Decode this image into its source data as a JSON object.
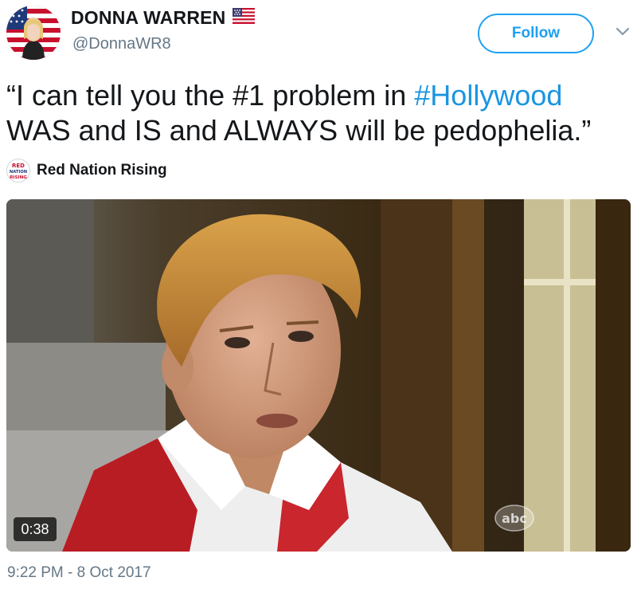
{
  "author": {
    "display_name": "DONNA WARREN",
    "handle": "@DonnaWR8",
    "name_badge_icon": "us-flag-icon",
    "avatar_icon": "profile-avatar"
  },
  "actions": {
    "follow_label": "Follow",
    "menu_icon": "chevron-down-icon"
  },
  "tweet": {
    "text_before": "“I can tell you the #1 problem in ",
    "hashtag": "#Hollywood",
    "text_after": " WAS and IS and ALWAYS will be pedophelia.”"
  },
  "attribution": {
    "logo_text": [
      "RED",
      "NATION",
      "RISING"
    ],
    "name": "Red Nation Rising"
  },
  "video": {
    "duration": "0:38",
    "watermark": "abc"
  },
  "meta": {
    "timestamp": "9:22 PM - 8 Oct 2017"
  },
  "colors": {
    "accent": "#1da1f2",
    "hashtag": "#1b95e0",
    "secondary_text": "#657786",
    "primary_text": "#14171a"
  }
}
